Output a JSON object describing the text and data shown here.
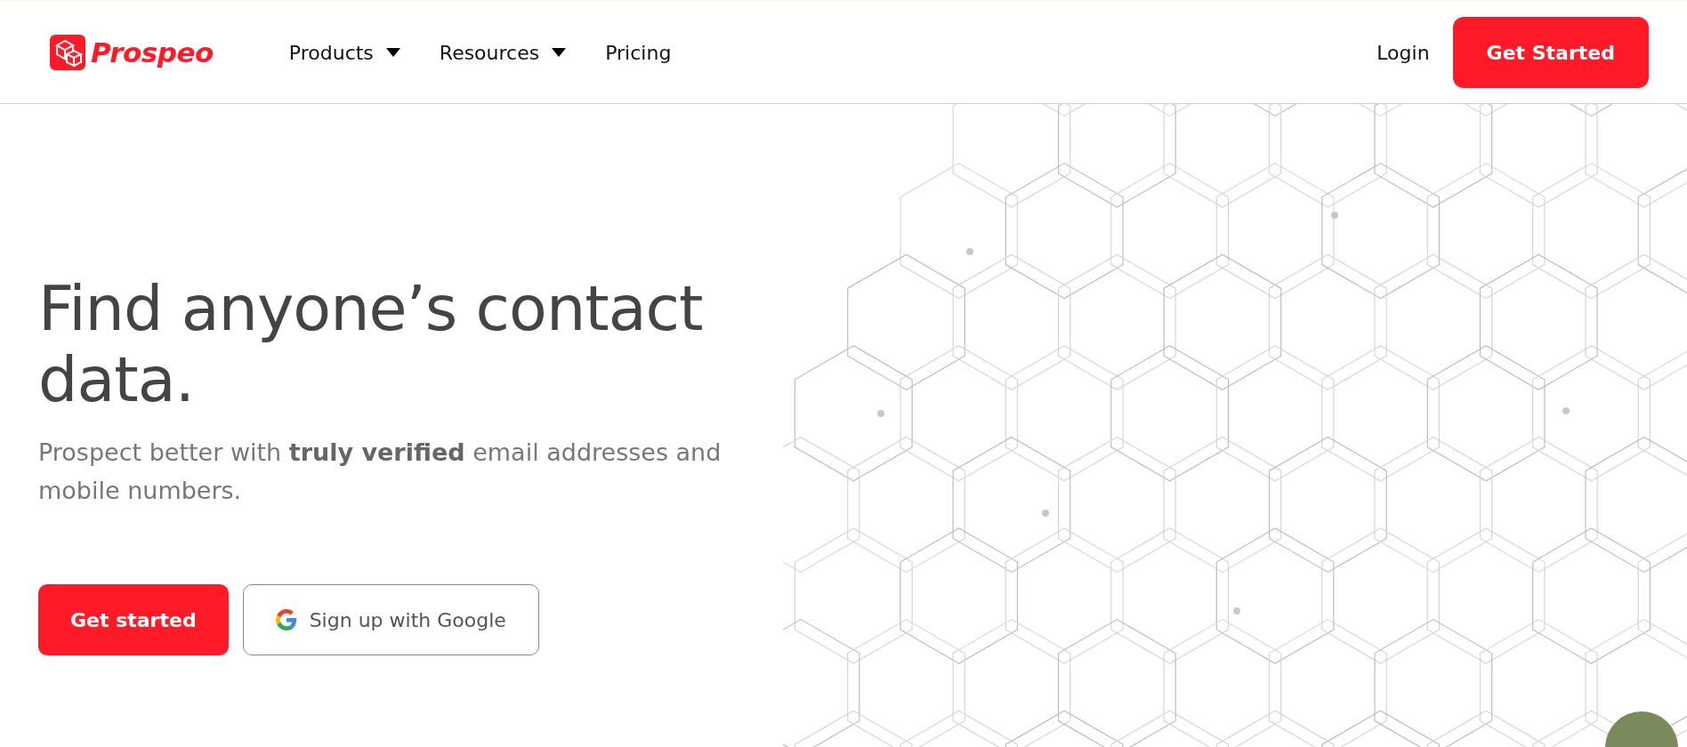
{
  "header": {
    "logo": "Prospeo",
    "nav": [
      {
        "label": "Products",
        "dropdown": true
      },
      {
        "label": "Resources",
        "dropdown": true
      },
      {
        "label": "Pricing",
        "dropdown": false
      }
    ],
    "login": "Login",
    "cta": "Get Started"
  },
  "hero": {
    "title": "Find anyone’s contact data.",
    "subtitle": "Prospect better with **truly verified** email addresses and mobile numbers.",
    "buttons": [
      {
        "kind": "primary",
        "label": "Get started"
      },
      {
        "kind": "google",
        "label": "Sign up with Google"
      }
    ]
  }
}
